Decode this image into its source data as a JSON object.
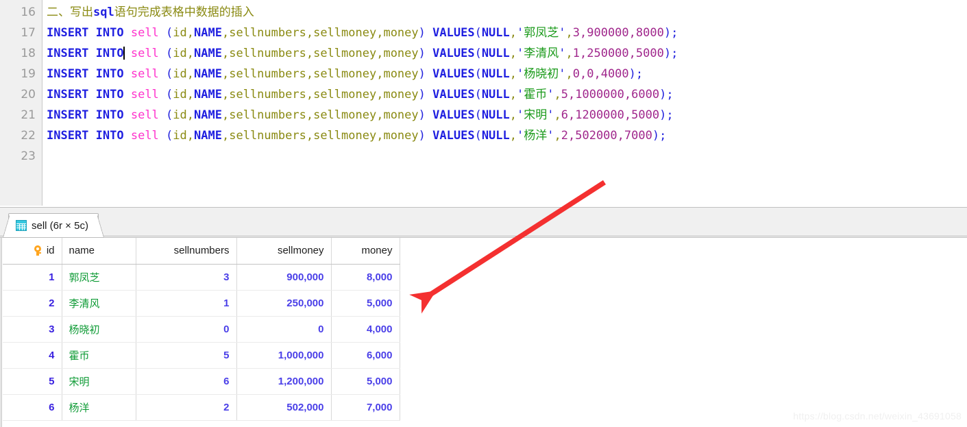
{
  "editor": {
    "lines": [
      {
        "number": "16",
        "kind": "comment",
        "segments": [
          {
            "text": "二、写出",
            "style": "comment"
          },
          {
            "text": "sql",
            "style": "comment-b"
          },
          {
            "text": "语句完成表格中数据的插入",
            "style": "comment"
          }
        ]
      },
      {
        "number": "17",
        "kind": "sql",
        "segments": [
          {
            "text": "INSERT INTO",
            "style": "kw"
          },
          {
            "text": " ",
            "style": "plain"
          },
          {
            "text": "sell",
            "style": "table"
          },
          {
            "text": " ",
            "style": "plain"
          },
          {
            "text": "(",
            "style": "paren"
          },
          {
            "text": "id",
            "style": "col"
          },
          {
            "text": ",",
            "style": "punct"
          },
          {
            "text": "NAME",
            "style": "colkw"
          },
          {
            "text": ",",
            "style": "punct"
          },
          {
            "text": "sellnumbers",
            "style": "col"
          },
          {
            "text": ",",
            "style": "punct"
          },
          {
            "text": "sellmoney",
            "style": "col"
          },
          {
            "text": ",",
            "style": "punct"
          },
          {
            "text": "money",
            "style": "col"
          },
          {
            "text": ")",
            "style": "paren"
          },
          {
            "text": " ",
            "style": "plain"
          },
          {
            "text": "VALUES",
            "style": "kw"
          },
          {
            "text": "(",
            "style": "paren"
          },
          {
            "text": "NULL",
            "style": "kw"
          },
          {
            "text": ",",
            "style": "punct"
          },
          {
            "text": "'",
            "style": "quote"
          },
          {
            "text": "郭凤芝",
            "style": "str"
          },
          {
            "text": "'",
            "style": "quote"
          },
          {
            "text": ",",
            "style": "punct"
          },
          {
            "text": "3,900000,8000",
            "style": "num"
          },
          {
            "text": ")",
            "style": "paren"
          },
          {
            "text": ";",
            "style": "semi"
          }
        ]
      },
      {
        "number": "18",
        "kind": "sql",
        "caret_after": 0,
        "segments": [
          {
            "text": "INSERT INTO",
            "style": "kw"
          },
          {
            "text": " ",
            "style": "plain"
          },
          {
            "text": "sell",
            "style": "table"
          },
          {
            "text": " ",
            "style": "plain"
          },
          {
            "text": "(",
            "style": "paren"
          },
          {
            "text": "id",
            "style": "col"
          },
          {
            "text": ",",
            "style": "punct"
          },
          {
            "text": "NAME",
            "style": "colkw"
          },
          {
            "text": ",",
            "style": "punct"
          },
          {
            "text": "sellnumbers",
            "style": "col"
          },
          {
            "text": ",",
            "style": "punct"
          },
          {
            "text": "sellmoney",
            "style": "col"
          },
          {
            "text": ",",
            "style": "punct"
          },
          {
            "text": "money",
            "style": "col"
          },
          {
            "text": ")",
            "style": "paren"
          },
          {
            "text": " ",
            "style": "plain"
          },
          {
            "text": "VALUES",
            "style": "kw"
          },
          {
            "text": "(",
            "style": "paren"
          },
          {
            "text": "NULL",
            "style": "kw"
          },
          {
            "text": ",",
            "style": "punct"
          },
          {
            "text": "'",
            "style": "quote"
          },
          {
            "text": "李清风",
            "style": "str"
          },
          {
            "text": "'",
            "style": "quote"
          },
          {
            "text": ",",
            "style": "punct"
          },
          {
            "text": "1,250000,5000",
            "style": "num"
          },
          {
            "text": ")",
            "style": "paren"
          },
          {
            "text": ";",
            "style": "semi"
          }
        ]
      },
      {
        "number": "19",
        "kind": "sql",
        "segments": [
          {
            "text": "INSERT INTO",
            "style": "kw"
          },
          {
            "text": " ",
            "style": "plain"
          },
          {
            "text": "sell",
            "style": "table"
          },
          {
            "text": " ",
            "style": "plain"
          },
          {
            "text": "(",
            "style": "paren"
          },
          {
            "text": "id",
            "style": "col"
          },
          {
            "text": ",",
            "style": "punct"
          },
          {
            "text": "NAME",
            "style": "colkw"
          },
          {
            "text": ",",
            "style": "punct"
          },
          {
            "text": "sellnumbers",
            "style": "col"
          },
          {
            "text": ",",
            "style": "punct"
          },
          {
            "text": "sellmoney",
            "style": "col"
          },
          {
            "text": ",",
            "style": "punct"
          },
          {
            "text": "money",
            "style": "col"
          },
          {
            "text": ")",
            "style": "paren"
          },
          {
            "text": " ",
            "style": "plain"
          },
          {
            "text": "VALUES",
            "style": "kw"
          },
          {
            "text": "(",
            "style": "paren"
          },
          {
            "text": "NULL",
            "style": "kw"
          },
          {
            "text": ",",
            "style": "punct"
          },
          {
            "text": "'",
            "style": "quote"
          },
          {
            "text": "杨晓初",
            "style": "str"
          },
          {
            "text": "'",
            "style": "quote"
          },
          {
            "text": ",",
            "style": "punct"
          },
          {
            "text": "0,0,4000",
            "style": "num"
          },
          {
            "text": ")",
            "style": "paren"
          },
          {
            "text": ";",
            "style": "semi"
          }
        ]
      },
      {
        "number": "20",
        "kind": "sql",
        "segments": [
          {
            "text": "INSERT INTO",
            "style": "kw"
          },
          {
            "text": " ",
            "style": "plain"
          },
          {
            "text": "sell",
            "style": "table"
          },
          {
            "text": " ",
            "style": "plain"
          },
          {
            "text": "(",
            "style": "paren"
          },
          {
            "text": "id",
            "style": "col"
          },
          {
            "text": ",",
            "style": "punct"
          },
          {
            "text": "NAME",
            "style": "colkw"
          },
          {
            "text": ",",
            "style": "punct"
          },
          {
            "text": "sellnumbers",
            "style": "col"
          },
          {
            "text": ",",
            "style": "punct"
          },
          {
            "text": "sellmoney",
            "style": "col"
          },
          {
            "text": ",",
            "style": "punct"
          },
          {
            "text": "money",
            "style": "col"
          },
          {
            "text": ")",
            "style": "paren"
          },
          {
            "text": " ",
            "style": "plain"
          },
          {
            "text": "VALUES",
            "style": "kw"
          },
          {
            "text": "(",
            "style": "paren"
          },
          {
            "text": "NULL",
            "style": "kw"
          },
          {
            "text": ",",
            "style": "punct"
          },
          {
            "text": "'",
            "style": "quote"
          },
          {
            "text": "霍币",
            "style": "str"
          },
          {
            "text": "'",
            "style": "quote"
          },
          {
            "text": ",",
            "style": "punct"
          },
          {
            "text": "5,1000000,6000",
            "style": "num"
          },
          {
            "text": ")",
            "style": "paren"
          },
          {
            "text": ";",
            "style": "semi"
          }
        ]
      },
      {
        "number": "21",
        "kind": "sql",
        "segments": [
          {
            "text": "INSERT INTO",
            "style": "kw"
          },
          {
            "text": " ",
            "style": "plain"
          },
          {
            "text": "sell",
            "style": "table"
          },
          {
            "text": " ",
            "style": "plain"
          },
          {
            "text": "(",
            "style": "paren"
          },
          {
            "text": "id",
            "style": "col"
          },
          {
            "text": ",",
            "style": "punct"
          },
          {
            "text": "NAME",
            "style": "colkw"
          },
          {
            "text": ",",
            "style": "punct"
          },
          {
            "text": "sellnumbers",
            "style": "col"
          },
          {
            "text": ",",
            "style": "punct"
          },
          {
            "text": "sellmoney",
            "style": "col"
          },
          {
            "text": ",",
            "style": "punct"
          },
          {
            "text": "money",
            "style": "col"
          },
          {
            "text": ")",
            "style": "paren"
          },
          {
            "text": " ",
            "style": "plain"
          },
          {
            "text": "VALUES",
            "style": "kw"
          },
          {
            "text": "(",
            "style": "paren"
          },
          {
            "text": "NULL",
            "style": "kw"
          },
          {
            "text": ",",
            "style": "punct"
          },
          {
            "text": "'",
            "style": "quote"
          },
          {
            "text": "宋明",
            "style": "str"
          },
          {
            "text": "'",
            "style": "quote"
          },
          {
            "text": ",",
            "style": "punct"
          },
          {
            "text": "6,1200000,5000",
            "style": "num"
          },
          {
            "text": ")",
            "style": "paren"
          },
          {
            "text": ";",
            "style": "semi"
          }
        ]
      },
      {
        "number": "22",
        "kind": "sql",
        "segments": [
          {
            "text": "INSERT INTO",
            "style": "kw"
          },
          {
            "text": " ",
            "style": "plain"
          },
          {
            "text": "sell",
            "style": "table"
          },
          {
            "text": " ",
            "style": "plain"
          },
          {
            "text": "(",
            "style": "paren"
          },
          {
            "text": "id",
            "style": "col"
          },
          {
            "text": ",",
            "style": "punct"
          },
          {
            "text": "NAME",
            "style": "colkw"
          },
          {
            "text": ",",
            "style": "punct"
          },
          {
            "text": "sellnumbers",
            "style": "col"
          },
          {
            "text": ",",
            "style": "punct"
          },
          {
            "text": "sellmoney",
            "style": "col"
          },
          {
            "text": ",",
            "style": "punct"
          },
          {
            "text": "money",
            "style": "col"
          },
          {
            "text": ")",
            "style": "paren"
          },
          {
            "text": " ",
            "style": "plain"
          },
          {
            "text": "VALUES",
            "style": "kw"
          },
          {
            "text": "(",
            "style": "paren"
          },
          {
            "text": "NULL",
            "style": "kw"
          },
          {
            "text": ",",
            "style": "punct"
          },
          {
            "text": "'",
            "style": "quote"
          },
          {
            "text": "杨洋",
            "style": "str"
          },
          {
            "text": "'",
            "style": "quote"
          },
          {
            "text": ",",
            "style": "punct"
          },
          {
            "text": "2,502000,7000",
            "style": "num"
          },
          {
            "text": ")",
            "style": "paren"
          },
          {
            "text": ";",
            "style": "semi"
          }
        ]
      },
      {
        "number": "23",
        "kind": "empty",
        "segments": []
      }
    ]
  },
  "result": {
    "tab": {
      "icon": "grid-icon",
      "label": "sell (6r × 5c)"
    },
    "grid": {
      "columns": [
        {
          "key": "id",
          "label": "id",
          "align": "right",
          "primary_key": true
        },
        {
          "key": "name",
          "label": "name",
          "align": "left",
          "primary_key": false
        },
        {
          "key": "sellnumbers",
          "label": "sellnumbers",
          "align": "right",
          "primary_key": false
        },
        {
          "key": "sellmoney",
          "label": "sellmoney",
          "align": "right",
          "primary_key": false
        },
        {
          "key": "money",
          "label": "money",
          "align": "right",
          "primary_key": false
        }
      ],
      "rows": [
        {
          "id": "1",
          "name": "郭凤芝",
          "sellnumbers": "3",
          "sellmoney": "900,000",
          "money": "8,000"
        },
        {
          "id": "2",
          "name": "李清风",
          "sellnumbers": "1",
          "sellmoney": "250,000",
          "money": "5,000"
        },
        {
          "id": "3",
          "name": "杨晓初",
          "sellnumbers": "0",
          "sellmoney": "0",
          "money": "4,000"
        },
        {
          "id": "4",
          "name": "霍币",
          "sellnumbers": "5",
          "sellmoney": "1,000,000",
          "money": "6,000"
        },
        {
          "id": "5",
          "name": "宋明",
          "sellnumbers": "6",
          "sellmoney": "1,200,000",
          "money": "5,000"
        },
        {
          "id": "6",
          "name": "杨洋",
          "sellnumbers": "2",
          "sellmoney": "502,000",
          "money": "7,000"
        }
      ]
    }
  },
  "annotation": {
    "arrow_color": "#f43030"
  },
  "watermark": {
    "text": "https://blog.csdn.net/weixin_43691058"
  }
}
